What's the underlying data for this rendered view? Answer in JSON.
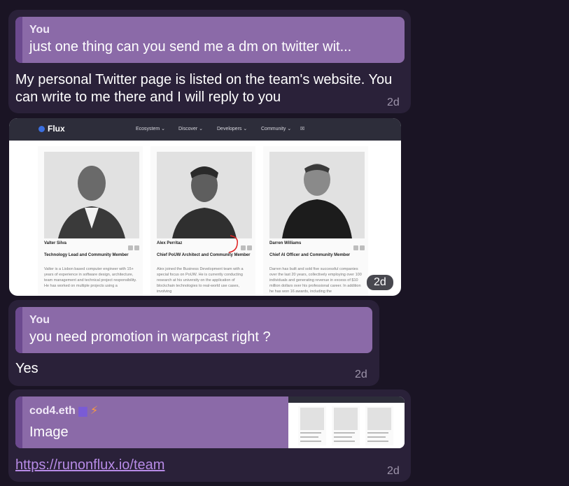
{
  "messages": [
    {
      "reply_author": "You",
      "reply_quote": "just one thing can you send me a dm on twitter wit...",
      "text_line1": "My personal Twitter page is listed on the team's website. You",
      "text_line2": "can write to me there and I will reply to you",
      "time": "2d"
    },
    {
      "time": "2d",
      "screenshot": {
        "logo": "Flux",
        "nav": [
          "Ecosystem ⌄",
          "Discover ⌄",
          "Developers ⌄",
          "Community ⌄"
        ],
        "people": [
          {
            "name": "Valter Silva",
            "role": "Technology Lead and Community Member",
            "desc": "Valter is a Lisbon based computer engineer with 15+ years of experience in software design, architecture, team management and technical project responsibility. He has worked on multiple projects using a"
          },
          {
            "name": "Alex Perritaz",
            "role": "Chief PoUW Architect and Community Member",
            "desc": "Alex joined the Business Development team with a special focus on PoUW. He is currently conducting research at his university on the application of blockchain technologies to real-world use cases, involving"
          },
          {
            "name": "Darren Williams",
            "role": "Chief AI Officer and Community Member",
            "desc": "Darren has built and sold five successful companies over the last 20 years, collectively employing over 100 individuals and generating revenue in excess of $10 million dollars over his professional career. In addition he has won 16 awards, including the"
          }
        ]
      }
    },
    {
      "reply_author": "You",
      "reply_quote": "you need promotion in warpcast right ?",
      "text": "Yes",
      "time": "2d"
    },
    {
      "reply_author": "cod4.eth",
      "reply_quote": "Image",
      "link": "https://runonflux.io/team",
      "time": "2d"
    }
  ],
  "colors": {
    "background": "#1a1424",
    "bubble": "#2a2139",
    "reply": "#8b6aa8",
    "reply_bar": "#6c4a8f",
    "link": "#b78be6"
  }
}
